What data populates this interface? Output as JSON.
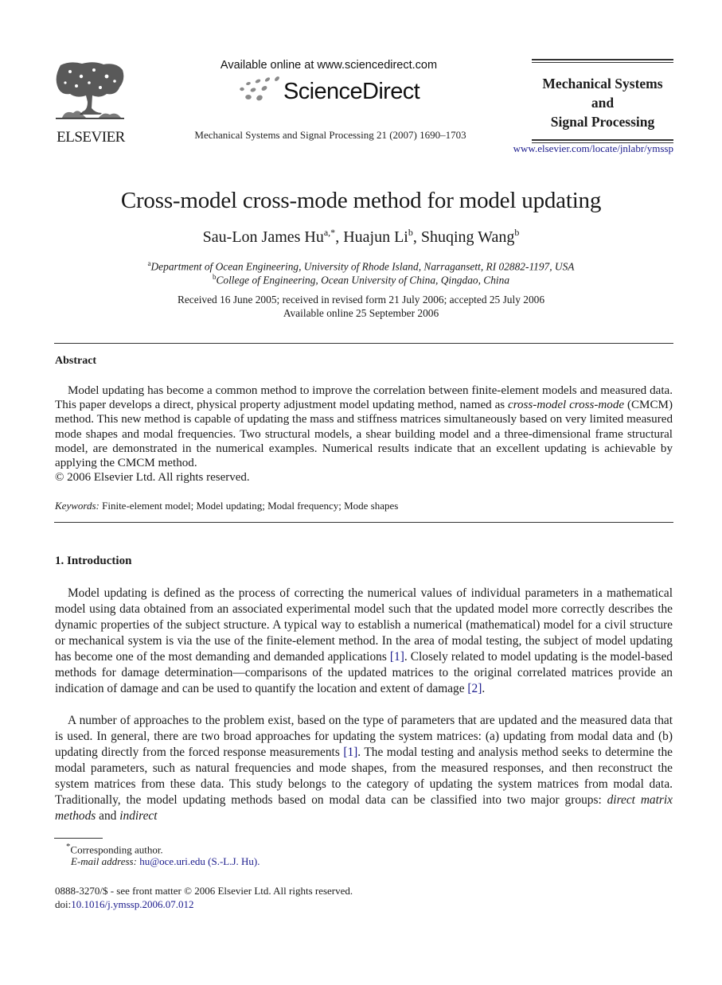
{
  "header": {
    "publisher_logo": "ELSEVIER",
    "available_online": "Available online at www.sciencedirect.com",
    "sciencedirect_brand": "ScienceDirect",
    "journal_citation": "Mechanical Systems and Signal Processing 21 (2007) 1690–1703",
    "journal_name_lines": [
      "Mechanical Systems",
      "and",
      "Signal Processing"
    ],
    "journal_url": "www.elsevier.com/locate/jnlabr/ymssp"
  },
  "article": {
    "title": "Cross-model cross-mode method for model updating",
    "authors": [
      {
        "name": "Sau-Lon James Hu",
        "sup": "a,*"
      },
      {
        "name": "Huajun Li",
        "sup": "b"
      },
      {
        "name": "Shuqing Wang",
        "sup": "b"
      }
    ],
    "affiliations": [
      {
        "sup": "a",
        "text": "Department of Ocean Engineering, University of Rhode Island, Narragansett, RI 02882-1197, USA"
      },
      {
        "sup": "b",
        "text": "College of Engineering, Ocean University of China, Qingdao, China"
      }
    ],
    "history": "Received 16 June 2005; received in revised form 21 July 2006; accepted 25 July 2006",
    "available_online": "Available online 25 September 2006"
  },
  "abstract": {
    "heading": "Abstract",
    "text_before_italic": "Model updating has become a common method to improve the correlation between finite-element models and measured data. This paper develops a direct, physical property adjustment model updating method, named as ",
    "italic": "cross-model cross-mode",
    "text_after_italic": " (CMCM) method. This new method is capable of updating the mass and stiffness matrices simultaneously based on very limited measured mode shapes and modal frequencies. Two structural models, a shear building model and a three-dimensional frame structural model, are demonstrated in the numerical examples. Numerical results indicate that an excellent updating is achievable by applying the CMCM method.",
    "copyright": "© 2006 Elsevier Ltd. All rights reserved.",
    "keywords_label": "Keywords:",
    "keywords": "Finite-element model; Model updating; Modal frequency; Mode shapes"
  },
  "introduction": {
    "heading": "1.  Introduction",
    "p1": {
      "a": "Model updating is defined as the process of correcting the numerical values of individual parameters in a mathematical model using data obtained from an associated experimental model such that the updated model more correctly describes the dynamic properties of the subject structure. A typical way to establish a numerical (mathematical) model for a civil structure or mechanical system is via the use of the finite-element method. In the area of modal testing, the subject of model updating has become one of the most demanding and demanded applications ",
      "ref1": "[1]",
      "b": ". Closely related to model updating is the model-based methods for damage determination—comparisons of the updated matrices to the original correlated matrices provide an indication of damage and can be used to quantify the location and extent of damage ",
      "ref2": "[2]",
      "c": "."
    },
    "p2": {
      "a": "A number of approaches to the problem exist, based on the type of parameters that are updated and the measured data that is used. In general, there are two broad approaches for updating the system matrices: (a) updating from modal data and (b) updating directly from the forced response measurements ",
      "ref1": "[1]",
      "b": ". The modal testing and analysis method seeks to determine the modal parameters, such as natural frequencies and mode shapes, from the measured responses, and then reconstruct the system matrices from these data. This study belongs to the category of updating the system matrices from modal data. Traditionally, the model updating methods based on modal data can be classified into two major groups: ",
      "italic1": "direct matrix methods",
      "mid": " and ",
      "italic2": "indirect"
    }
  },
  "footnotes": {
    "corresponding_mark": "*",
    "corresponding": "Corresponding author.",
    "email_label": "E-mail address:",
    "email": "hu@oce.uri.edu (S.-L.J. Hu).",
    "issn": "0888-3270/$ - see front matter © 2006 Elsevier Ltd. All rights reserved.",
    "doi_label": "doi:",
    "doi": "10.1016/j.ymssp.2006.07.012"
  }
}
